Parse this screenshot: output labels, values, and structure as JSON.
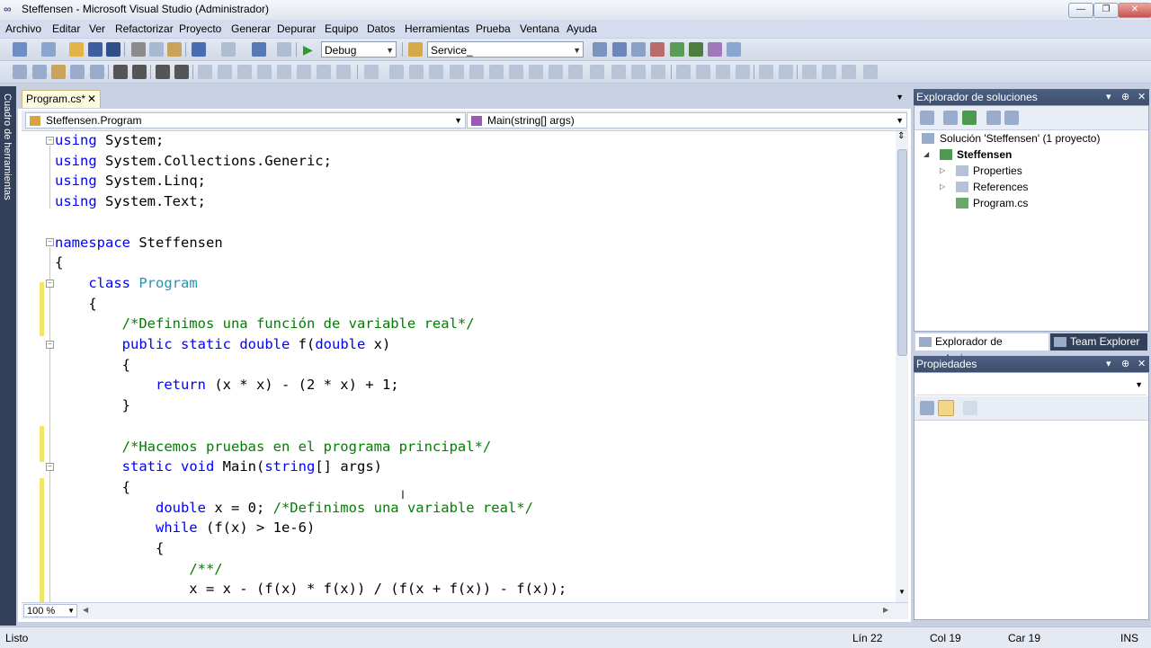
{
  "window": {
    "title": "Steffensen - Microsoft Visual Studio (Administrador)",
    "logo_icon": "visual-studio-infinity-icon",
    "minimize_glyph": "—",
    "maximize_glyph": "❐",
    "close_glyph": "✕"
  },
  "menu": [
    "Archivo",
    "Editar",
    "Ver",
    "Refactorizar",
    "Proyecto",
    "Generar",
    "Depurar",
    "Equipo",
    "Datos",
    "Herramientas",
    "Prueba",
    "Ventana",
    "Ayuda"
  ],
  "toolbar": {
    "configuration": "Debug",
    "find_value": "Service_"
  },
  "left_rail": {
    "label": "Cuadro de herramientas"
  },
  "editor": {
    "tab_label": "Program.cs*",
    "tab_close": "✕",
    "nav_class": "Steffensen.Program",
    "nav_member": "Main(string[] args)",
    "zoom": "100 %",
    "code": [
      [
        {
          "t": "using",
          "c": "kw"
        },
        {
          "t": " System;"
        }
      ],
      [
        {
          "t": "using",
          "c": "kw"
        },
        {
          "t": " System.Collections.Generic;"
        }
      ],
      [
        {
          "t": "using",
          "c": "kw"
        },
        {
          "t": " System.Linq;"
        }
      ],
      [
        {
          "t": "using",
          "c": "kw"
        },
        {
          "t": " System.Text;"
        }
      ],
      [],
      [
        {
          "t": "namespace",
          "c": "kw"
        },
        {
          "t": " Steffensen"
        }
      ],
      [
        {
          "t": "{"
        }
      ],
      [
        {
          "t": "    "
        },
        {
          "t": "class",
          "c": "kw"
        },
        {
          "t": " "
        },
        {
          "t": "Program",
          "c": "ty"
        }
      ],
      [
        {
          "t": "    {"
        }
      ],
      [
        {
          "t": "        "
        },
        {
          "t": "/*Definimos una función de variable real*/",
          "c": "cm"
        }
      ],
      [
        {
          "t": "        "
        },
        {
          "t": "public",
          "c": "kw"
        },
        {
          "t": " "
        },
        {
          "t": "static",
          "c": "kw"
        },
        {
          "t": " "
        },
        {
          "t": "double",
          "c": "kw"
        },
        {
          "t": " f("
        },
        {
          "t": "double",
          "c": "kw"
        },
        {
          "t": " x)"
        }
      ],
      [
        {
          "t": "        {"
        }
      ],
      [
        {
          "t": "            "
        },
        {
          "t": "return",
          "c": "kw"
        },
        {
          "t": " (x * x) - (2 * x) + 1;"
        }
      ],
      [
        {
          "t": "        }"
        }
      ],
      [],
      [
        {
          "t": "        "
        },
        {
          "t": "/*Hacemos pruebas en el programa principal*/",
          "c": "cm"
        }
      ],
      [
        {
          "t": "        "
        },
        {
          "t": "static",
          "c": "kw"
        },
        {
          "t": " "
        },
        {
          "t": "void",
          "c": "kw"
        },
        {
          "t": " Main("
        },
        {
          "t": "string",
          "c": "kw"
        },
        {
          "t": "[] args)"
        }
      ],
      [
        {
          "t": "        {"
        }
      ],
      [
        {
          "t": "            "
        },
        {
          "t": "double",
          "c": "kw"
        },
        {
          "t": " x = 0; "
        },
        {
          "t": "/*Definimos una variable real*/",
          "c": "cm"
        }
      ],
      [
        {
          "t": "            "
        },
        {
          "t": "while",
          "c": "kw"
        },
        {
          "t": " (f(x) > 1e-6)"
        }
      ],
      [
        {
          "t": "            {"
        }
      ],
      [
        {
          "t": "                "
        },
        {
          "t": "/**/",
          "c": "cm"
        }
      ],
      [
        {
          "t": "                x = x - (f(x) * f(x)) / (f(x + f(x)) - f(x));"
        }
      ]
    ]
  },
  "solution_explorer": {
    "title": "Explorador de soluciones",
    "solution": "Solución 'Steffensen'  (1 proyecto)",
    "project": "Steffensen",
    "items": [
      "Properties",
      "References",
      "Program.cs"
    ],
    "tabs": [
      "Explorador de soluciones",
      "Team Explorer"
    ],
    "header_controls": [
      "▾",
      "⊕",
      "✕"
    ]
  },
  "properties": {
    "title": "Propiedades",
    "header_controls": [
      "▾",
      "⊕",
      "✕"
    ]
  },
  "status": {
    "ready": "Listo",
    "line": "Lín 22",
    "col": "Col 19",
    "char": "Car 19",
    "mode": "INS"
  }
}
